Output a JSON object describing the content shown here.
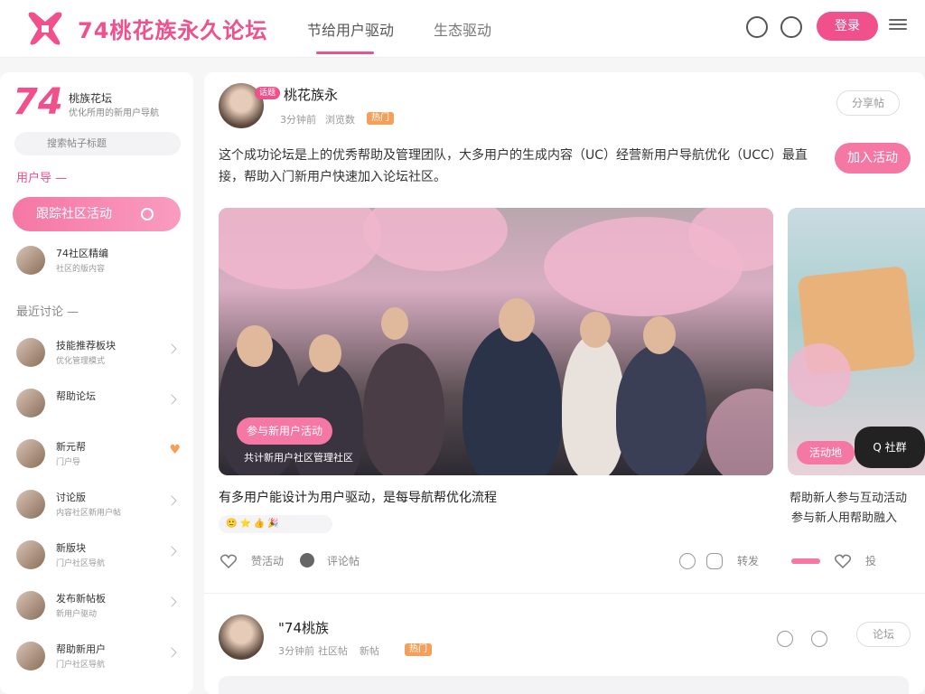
{
  "header": {
    "site_name": "74桃花族永久论坛",
    "tabs": [
      {
        "label": "节给用户驱动",
        "active": true
      },
      {
        "label": "生态驱动",
        "active": false
      }
    ],
    "login_label": "登录",
    "accent_color": "#f0508c"
  },
  "sidebar": {
    "brand_mark": "74",
    "brand_name": "桃族花坛",
    "brand_sub": "优化所用的新用户导航",
    "search_placeholder": "搜索帖子标题",
    "section_users": "用户导 —",
    "cta_label": "跟踪社区活动",
    "section_recent": "最近讨论 —",
    "top_item": {
      "name": "74社区精编",
      "sub": "社区的版内容"
    },
    "items": [
      {
        "name": "技能推荐板块",
        "sub": "优化管理模式"
      },
      {
        "name": "帮助论坛",
        "sub": ""
      },
      {
        "name": "新元帮",
        "sub": "门户导"
      },
      {
        "name": "讨论版",
        "sub": "内容社区新用户帖"
      },
      {
        "name": "新版块",
        "sub": "门户社区导航"
      },
      {
        "name": "发布新帖板",
        "sub": "新用户驱动"
      },
      {
        "name": "帮助新用户",
        "sub": "门户社区导航"
      }
    ]
  },
  "post1": {
    "badge": "话题",
    "author": "桃花族永",
    "meta_time": "3分钟前",
    "meta_views": "浏览数",
    "tag": "热门",
    "follow_label": "分享帖",
    "text": "这个成功论坛是上的优秀帮助及管理团队，大多用户的生成内容（UC）经营新用户导航优化（UCC）最直接，帮助入门新用户快速加入论坛社区。",
    "join_label": "加入活动",
    "image_pill": "参与新用户活动",
    "image_caption": "共计新用户社区管理社区",
    "side_pill": "活动地",
    "side_chat": "Q 社群",
    "caption_main": "有多用户能设计为用户驱动，是每导航帮优化流程",
    "caption_side_1": "帮助新人参与互动活动",
    "caption_side_2": "参与新人用帮助融入",
    "emoji_row": "🙂⭐👍🎉",
    "like_label": "赞活动",
    "comment_label": "评论帖",
    "share_label": "转发",
    "right_count": "投"
  },
  "post2": {
    "author": "\"74桃族",
    "meta_time": "3分钟前",
    "meta_views": "社区帖",
    "meta_more": "新帖",
    "tag": "热门",
    "follow_label": "论坛"
  }
}
